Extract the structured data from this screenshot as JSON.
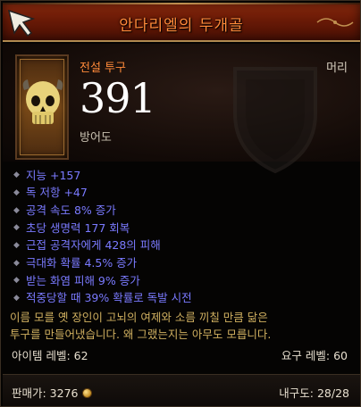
{
  "item": {
    "name": "안다리엘의 두개골",
    "type": "전설 투구",
    "slot": "머리",
    "armor_value": "391",
    "armor_label": "방어도"
  },
  "stats": [
    "지능 +157",
    "독 저항 +47",
    "공격 속도 8% 증가",
    "초당 생명력 177 회복",
    "근접 공격자에게 428의 피해",
    "극대화 확률 4.5% 증가",
    "받는 화염 피해 9% 증가",
    "적중당할 때 39% 확률로 독발 시전"
  ],
  "flavor": {
    "line1": "이름 모를 옛 장인이 고뇌의 여제와 소름 끼칠 만큼 닮은",
    "line2": "투구를 만들어냈습니다. 왜 그랬는지는 아무도 모릅니다."
  },
  "requirements": {
    "item_level": "아이템 레벨: 62",
    "required_level": "요구 레벨: 60"
  },
  "footer": {
    "sell_value": "판매가: 3276",
    "durability": "내구도: 28/28"
  },
  "colors": {
    "legendary": "#ff8a3a",
    "magic_stat": "#7a7aff",
    "flavor": "#d0b060"
  },
  "icons": [
    "cursor-arrow-icon",
    "skull-helm-icon",
    "shield-icon",
    "gold-coin-icon"
  ]
}
